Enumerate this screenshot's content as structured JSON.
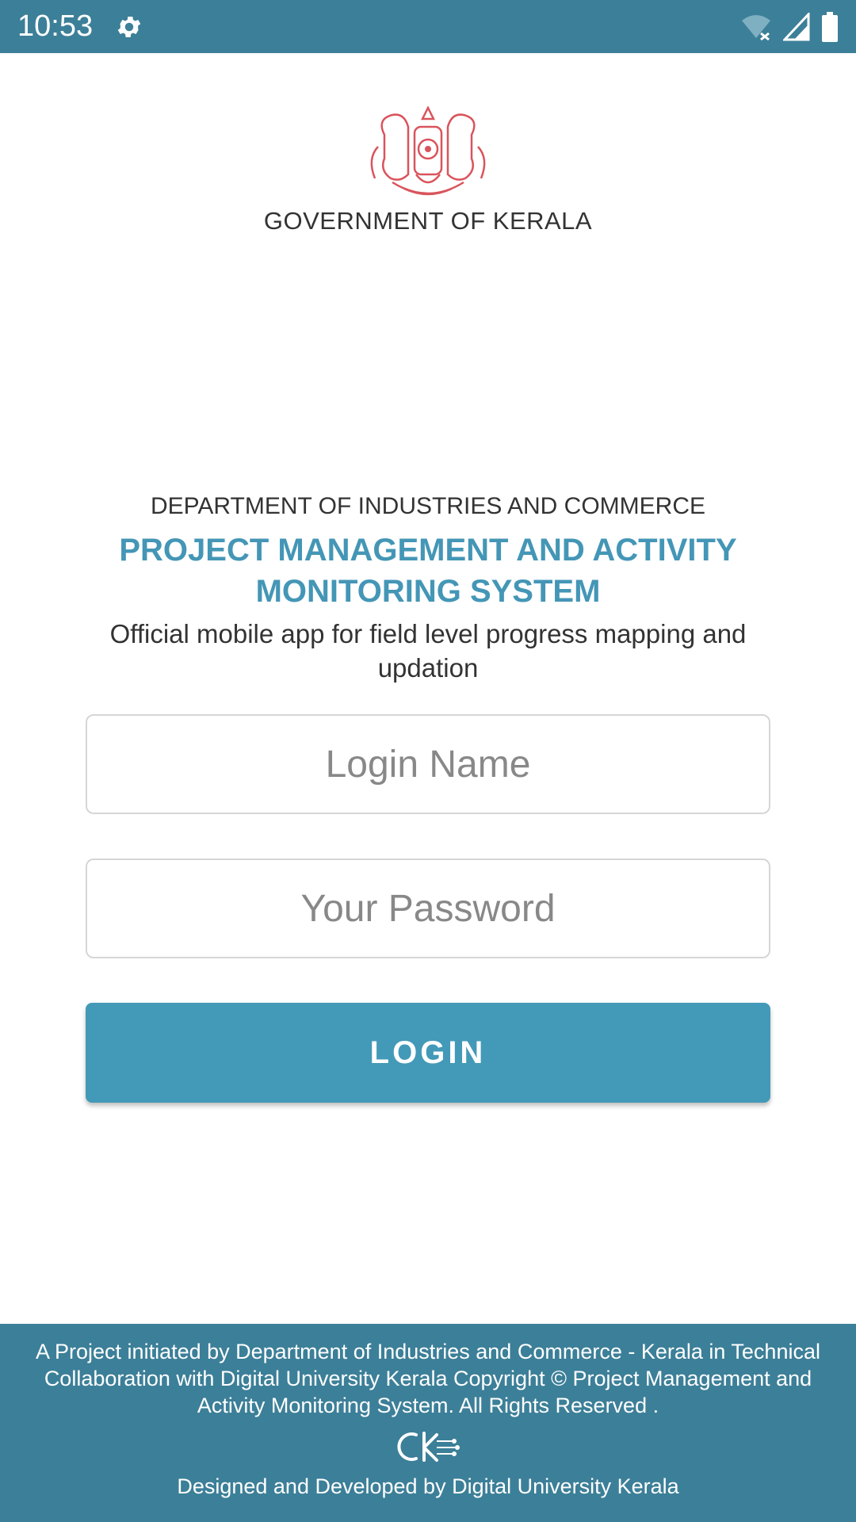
{
  "status_bar": {
    "time": "10:53"
  },
  "header": {
    "government": "GOVERNMENT OF KERALA"
  },
  "intro": {
    "department": "DEPARTMENT OF INDUSTRIES AND COMMERCE",
    "app_title": "PROJECT MANAGEMENT AND ACTIVITY MONITORING SYSTEM",
    "subtitle": "Official mobile app for field level progress mapping and updation"
  },
  "form": {
    "login_name_placeholder": "Login Name",
    "login_name_value": "",
    "password_placeholder": "Your Password",
    "password_value": "",
    "login_button": "LOGIN"
  },
  "footer": {
    "text": "A Project initiated by Department of Industries and Commerce - Kerala in Technical Collaboration with Digital University Kerala Copyright © Project Management and Activity Monitoring System. All Rights Reserved .",
    "credit": "Designed and Developed by Digital University Kerala"
  },
  "colors": {
    "bar": "#3c7f98",
    "accent": "#4399b8",
    "title": "#4496b6"
  },
  "icons": {
    "settings": "gear-icon",
    "wifi": "wifi-off-icon",
    "signal": "signal-icon",
    "battery": "battery-icon",
    "emblem": "kerala-emblem",
    "university_logo": "digital-university-logo"
  }
}
